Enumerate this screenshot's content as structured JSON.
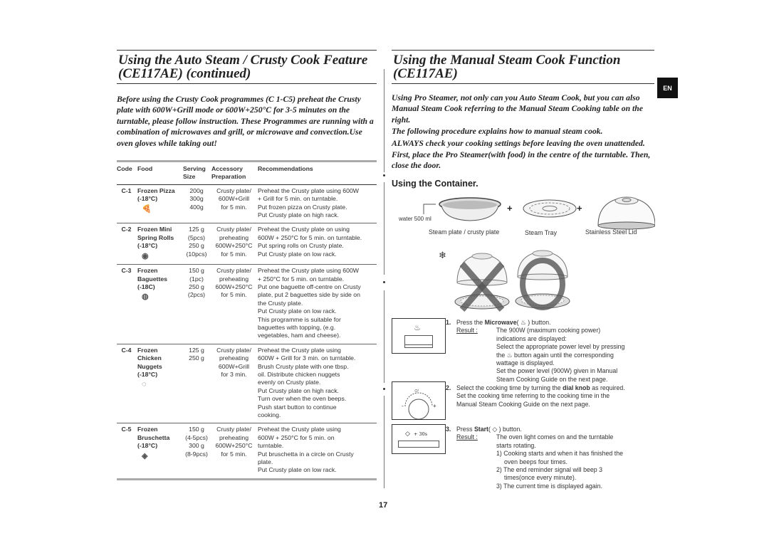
{
  "left": {
    "title_line1": "Using the Auto Steam / Crusty Cook Feature",
    "title_line2": "(CE117AE)  (continued)",
    "intro": "Before using the Crusty Cook programmes (C 1-C5) preheat the Crusty plate with 600W+Grill mode or 600W+250°C for 3-5 minutes on the turntable, please follow instruction. These Programmes are running with a combination of microwaves and grill, or microwave and convection.Use oven gloves while taking out!",
    "table": {
      "headers": {
        "code": "Code",
        "food": "Food",
        "size_line1": "Serving",
        "size_line2": "Size",
        "acc_line1": "Accessory",
        "acc_line2": "Preparation",
        "rec": "Recommendations"
      },
      "rows": [
        {
          "code": "C-1",
          "food": [
            "Frozen Pizza",
            "(-18°C)"
          ],
          "icon": "pizza-icon",
          "size": [
            "200g",
            "300g",
            "400g"
          ],
          "accessory": [
            "Crusty plate/",
            "600W+Grill",
            "for 5 min."
          ],
          "recommendations": [
            "Preheat the Crusty plate using 600W",
            "+ Grill for 5 min. on turntable.",
            "Put frozen pizza on Crusty plate.",
            "Put Crusty plate on high rack."
          ]
        },
        {
          "code": "C-2",
          "food": [
            "Frozen Mini",
            "Spring Rolls",
            "(-18°C)"
          ],
          "icon": "spring-rolls-icon",
          "size": [
            "125 g",
            "(5pcs)",
            "250 g",
            "(10pcs)"
          ],
          "accessory": [
            "Crusty plate/",
            "preheating",
            "600W+250°C",
            "for 5 min."
          ],
          "recommendations": [
            "Preheat the Crusty plate on using",
            "600W + 250°C for 5 min. on turntable.",
            "Put spring rolls on Crusty plate.",
            "Put Crusty plate on low rack."
          ]
        },
        {
          "code": "C-3",
          "food": [
            "Frozen",
            "Baguettes",
            "(-18C)"
          ],
          "icon": "baguette-icon",
          "size": [
            "150 g",
            "(1pc)",
            "250 g",
            "(2pcs)"
          ],
          "accessory": [
            "Crusty plate/",
            "preheating",
            "600W+250°C",
            "for 5 min."
          ],
          "recommendations": [
            "Preheat the Crusty plate using 600W",
            "+ 250°C for 5 min. on turntable.",
            "Put one baguette off-centre on Crusty",
            "plate, put 2 baguettes side by side on",
            "the Crusty plate.",
            "Put Crusty plate on low rack.",
            "This programme is suitable for",
            "baguettes with topping, (e.g.",
            "vegetables, ham and cheese)."
          ]
        },
        {
          "code": "C-4",
          "food": [
            "Frozen",
            "Chicken",
            "Nuggets",
            "(-18°C)"
          ],
          "icon": "chicken-nuggets-icon",
          "size": [
            "125 g",
            "250 g"
          ],
          "accessory": [
            "Crusty plate/",
            "preheating",
            "600W+Grill",
            "for 3 min."
          ],
          "recommendations": [
            "Preheat the Crusty plate using",
            "600W + Grill for 3 min. on turntable.",
            "Brush Crusty plate with one tbsp.",
            "oil. Distribute chicken nuggets",
            "evenly on Crusty plate.",
            "Put Crusty plate on high rack.",
            "Turn over when the oven beeps.",
            "Push start button to continue",
            "cooking."
          ]
        },
        {
          "code": "C-5",
          "food": [
            "Frozen",
            "Bruschetta",
            "(-18°C)"
          ],
          "icon": "bruschetta-icon",
          "size": [
            "150 g",
            "(4-5pcs)",
            "300 g",
            "(8-9pcs)"
          ],
          "accessory": [
            "Crusty plate/",
            "preheating",
            "600W+250°C",
            "for 5 min."
          ],
          "recommendations": [
            "Preheat the Crusty plate using",
            "600W + 250°C for 5 min. on",
            "turntable.",
            "Put bruschetta in a circle on Crusty",
            "plate.",
            "Put Crusty plate on low rack."
          ]
        }
      ]
    }
  },
  "right": {
    "title_line1": "Using the Manual Steam Cook Function",
    "title_line2": "(CE117AE)",
    "language_tab": "EN",
    "intro": [
      "Using Pro Steamer, not only can you Auto Steam Cook, but you can also Manual Steam Cook referring to the Manual Steam Cooking table on the right.",
      "The following procedure explains how to manual steam cook.",
      "ALWAYS check your cooking settings before leaving the oven unattended.",
      "First, place the Pro Steamer(with food) in the centre of the turntable. Then, close the door."
    ],
    "container_heading": "Using the Container.",
    "containers": {
      "water_label": "water 500 ml",
      "plate_label": "Steam plate / crusty plate",
      "tray_label": "Steam Tray",
      "lid_label": "Stainless Steel Lid",
      "plus": "+"
    },
    "steps": [
      {
        "num": "1.",
        "pre": "Press the ",
        "bold": "Microwave",
        "post": "( ♨ ) button.",
        "result_label": "Result :",
        "result_lines": [
          "The 900W (maximum cooking power)",
          "indications are displayed:",
          "Select the appropriate power level by pressing",
          "the ♨ button again until the corresponding",
          "wattage is displayed.",
          "Set the power level (900W) given in Manual",
          "Steam Cooking Guide on the next page."
        ]
      },
      {
        "num": "2.",
        "pre": "Select the cooking time by turning the ",
        "bold": "dial knob",
        "post": " as required.",
        "extra_lines": [
          "Set the cooking time referring to the cooking time in the",
          "Manual Steam Cooking Guide on the next page."
        ]
      },
      {
        "num": "3.",
        "pre": "Press ",
        "bold": "Start",
        "post": "( ◇ ) button.",
        "result_label": "Result :",
        "result_lines": [
          "The oven light comes on and the turntable",
          "starts rotating."
        ],
        "sub_items": [
          "1) Cooking starts and when it has finished the",
          "oven beeps four times.",
          "2) The end reminder signal will beep 3",
          "times(once every minute).",
          "3) The current time is displayed again."
        ]
      }
    ],
    "panel_start_label": "+ 30s"
  },
  "page_number": "17"
}
